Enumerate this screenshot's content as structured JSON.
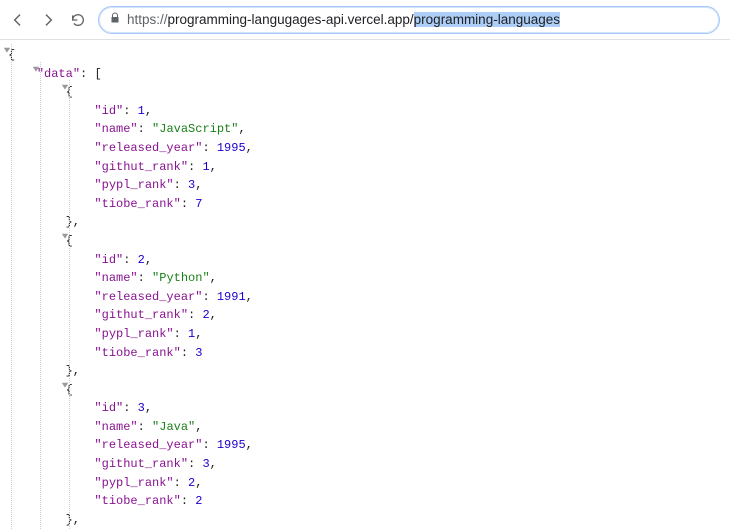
{
  "browser": {
    "url_scheme": "https://",
    "url_host": "programming-langugages-api.vercel.app/",
    "url_path_selected": "programming-languages"
  },
  "json_view": {
    "root_open": "{",
    "data_key": "\"data\"",
    "array_open": "[",
    "entries": [
      {
        "open": "{",
        "fields": [
          {
            "key": "\"id\"",
            "value": "1",
            "type": "n",
            "comma": true
          },
          {
            "key": "\"name\"",
            "value": "\"JavaScript\"",
            "type": "s",
            "comma": true
          },
          {
            "key": "\"released_year\"",
            "value": "1995",
            "type": "n",
            "comma": true
          },
          {
            "key": "\"githut_rank\"",
            "value": "1",
            "type": "n",
            "comma": true
          },
          {
            "key": "\"pypl_rank\"",
            "value": "3",
            "type": "n",
            "comma": true
          },
          {
            "key": "\"tiobe_rank\"",
            "value": "7",
            "type": "n",
            "comma": false
          }
        ],
        "close": "},"
      },
      {
        "open": "{",
        "fields": [
          {
            "key": "\"id\"",
            "value": "2",
            "type": "n",
            "comma": true
          },
          {
            "key": "\"name\"",
            "value": "\"Python\"",
            "type": "s",
            "comma": true
          },
          {
            "key": "\"released_year\"",
            "value": "1991",
            "type": "n",
            "comma": true
          },
          {
            "key": "\"githut_rank\"",
            "value": "2",
            "type": "n",
            "comma": true
          },
          {
            "key": "\"pypl_rank\"",
            "value": "1",
            "type": "n",
            "comma": true
          },
          {
            "key": "\"tiobe_rank\"",
            "value": "3",
            "type": "n",
            "comma": false
          }
        ],
        "close": "},"
      },
      {
        "open": "{",
        "fields": [
          {
            "key": "\"id\"",
            "value": "3",
            "type": "n",
            "comma": true
          },
          {
            "key": "\"name\"",
            "value": "\"Java\"",
            "type": "s",
            "comma": true
          },
          {
            "key": "\"released_year\"",
            "value": "1995",
            "type": "n",
            "comma": true
          },
          {
            "key": "\"githut_rank\"",
            "value": "3",
            "type": "n",
            "comma": true
          },
          {
            "key": "\"pypl_rank\"",
            "value": "2",
            "type": "n",
            "comma": true
          },
          {
            "key": "\"tiobe_rank\"",
            "value": "2",
            "type": "n",
            "comma": false
          }
        ],
        "close": "},"
      }
    ]
  }
}
